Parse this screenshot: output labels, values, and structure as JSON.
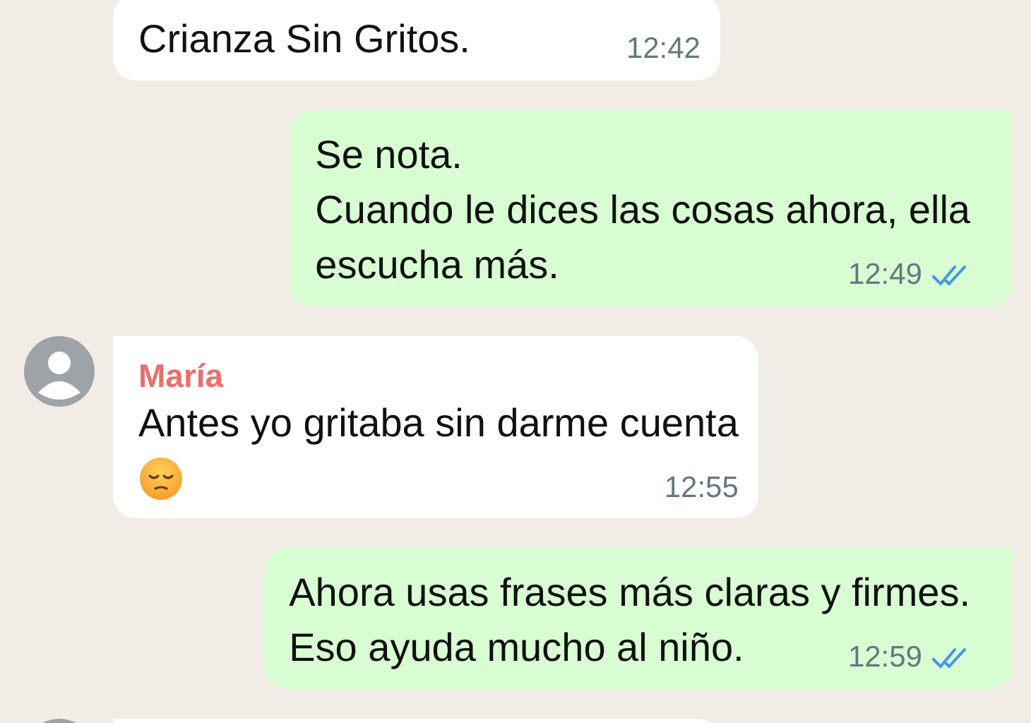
{
  "messages": [
    {
      "kind": "incoming",
      "show_avatar": false,
      "lines": [
        "Crianza Sin Gritos."
      ],
      "time": "12:42"
    },
    {
      "kind": "outgoing",
      "lines": [
        "Se nota.",
        "Cuando le dices las cosas ahora, ella",
        "escucha más."
      ],
      "time": "12:49",
      "read": true
    },
    {
      "kind": "incoming",
      "show_avatar": true,
      "sender": "María",
      "lines": [
        "Antes yo gritaba sin darme cuenta"
      ],
      "has_emoji": true,
      "time": "12:55"
    },
    {
      "kind": "outgoing",
      "lines": [
        "Ahora usas frases más claras y firmes.",
        "Eso ayuda mucho al niño."
      ],
      "time": "12:59",
      "read": true
    },
    {
      "kind": "incoming",
      "show_avatar": true
    }
  ]
}
